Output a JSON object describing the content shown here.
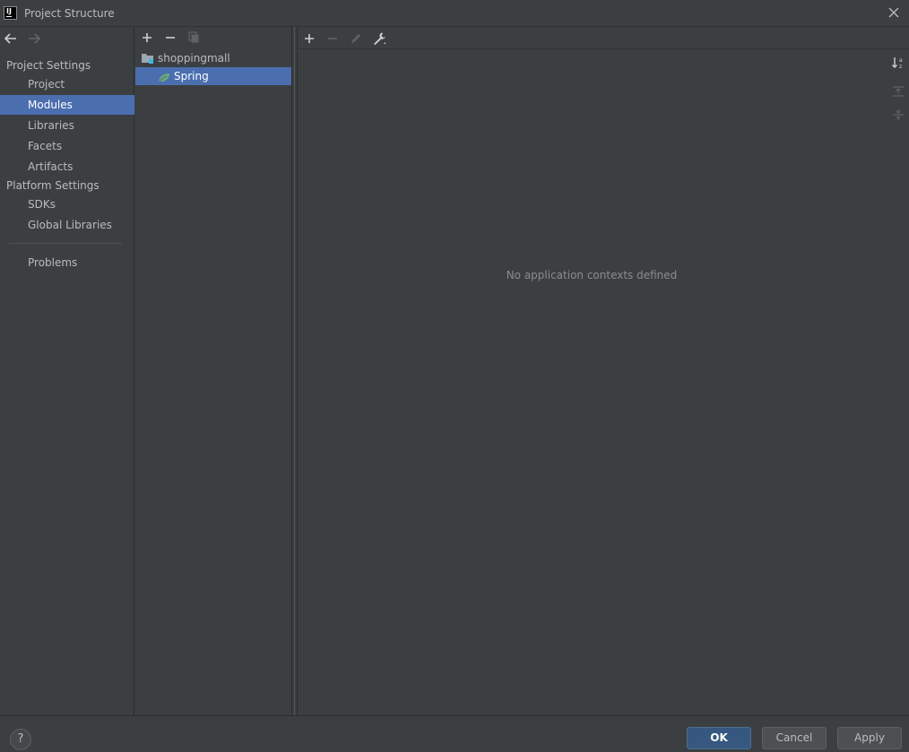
{
  "window": {
    "title": "Project Structure",
    "logo_text": "IJ"
  },
  "sidebar": {
    "project_settings_title": "Project Settings",
    "project_items": [
      {
        "label": "Project",
        "selected": false
      },
      {
        "label": "Modules",
        "selected": true
      },
      {
        "label": "Libraries",
        "selected": false
      },
      {
        "label": "Facets",
        "selected": false
      },
      {
        "label": "Artifacts",
        "selected": false
      }
    ],
    "platform_settings_title": "Platform Settings",
    "platform_items": [
      {
        "label": "SDKs"
      },
      {
        "label": "Global Libraries"
      }
    ],
    "problems_label": "Problems"
  },
  "modules": {
    "tree": [
      {
        "label": "shoppingmall",
        "type": "module",
        "selected": false
      },
      {
        "label": "Spring",
        "type": "facet",
        "selected": true
      }
    ]
  },
  "detail": {
    "empty_text": "No application contexts defined"
  },
  "buttons": {
    "help": "?",
    "ok": "OK",
    "cancel": "Cancel",
    "apply": "Apply"
  },
  "colors": {
    "background": "#3c3f41",
    "selection": "#4b6eaf",
    "spring_green": "#6aab73",
    "ok_button": "#365880"
  }
}
